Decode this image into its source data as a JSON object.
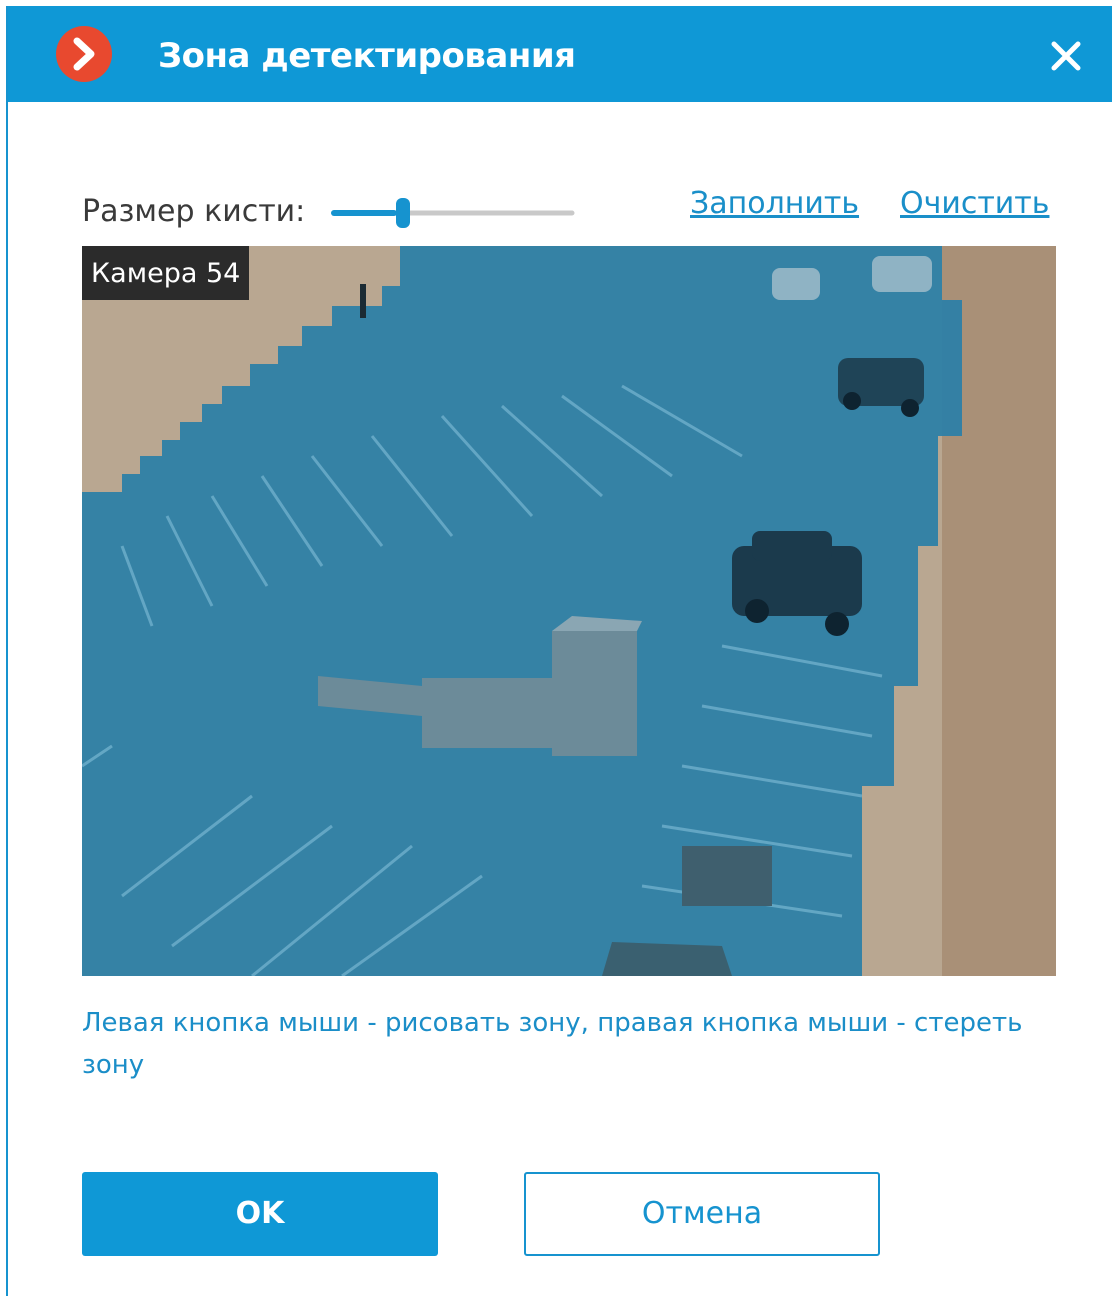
{
  "dialog": {
    "title": "Зона детектирования",
    "close_icon": "close-icon",
    "logo_icon": "chevron-right-circle-icon",
    "accent_color": "#0f98d6"
  },
  "brush": {
    "label": "Размер кисти:",
    "value_fraction": 0.3
  },
  "actions": {
    "fill": "Заполнить",
    "clear": "Очистить"
  },
  "camera": {
    "name": "Камера 54",
    "zone_color": "#1e7aa5"
  },
  "hint": "Левая кнопка мыши - рисовать зону, правая кнопка мыши - стереть зону",
  "buttons": {
    "ok": "OK",
    "cancel": "Отмена"
  }
}
